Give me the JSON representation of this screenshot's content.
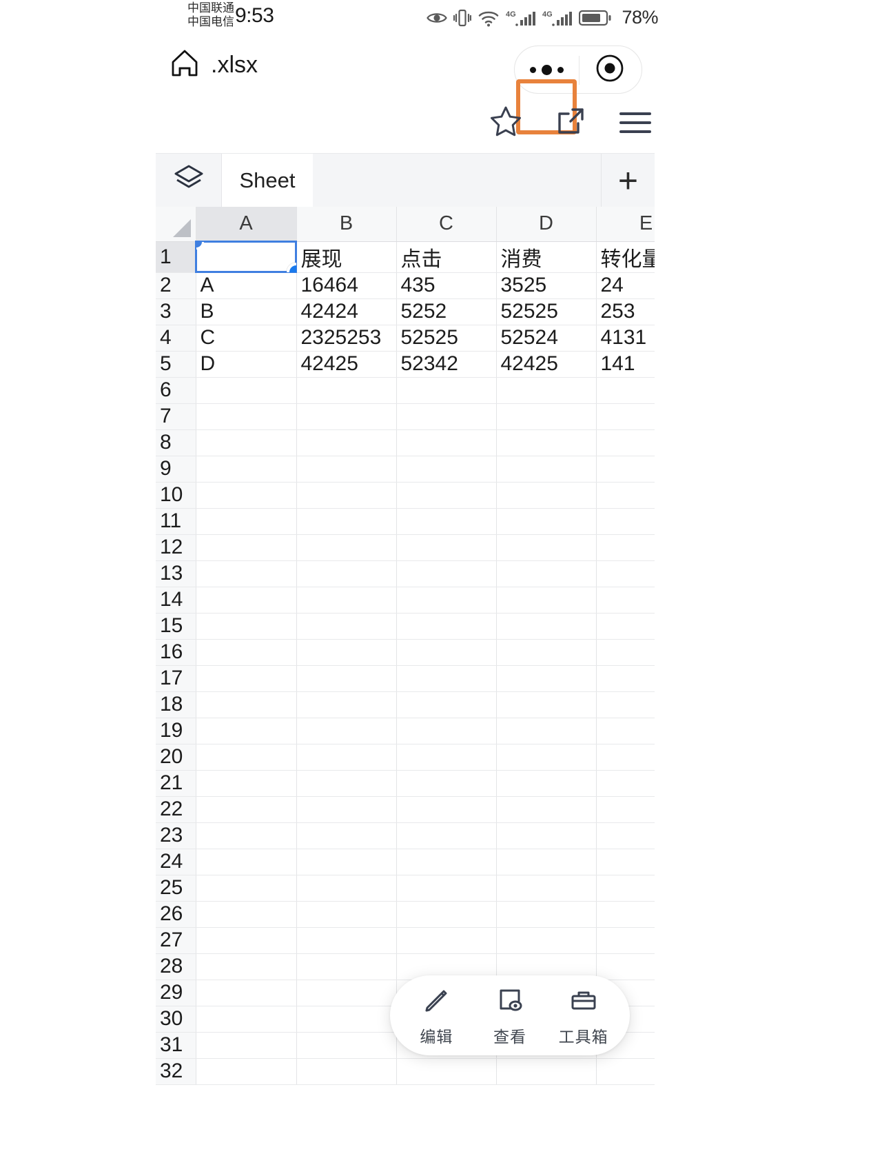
{
  "status_bar": {
    "carrier_1": "中国联通",
    "carrier_2": "中国电信",
    "time": "9:53",
    "battery_percent": "78%",
    "icons": [
      "eye-care-icon",
      "vibrate-icon",
      "wifi-icon",
      "signal-4g-icon",
      "signal-4g-icon-2",
      "battery-icon"
    ]
  },
  "title_bar": {
    "home_icon": "home-icon",
    "file_name": ".xlsx",
    "more_icon": "more-dots-icon",
    "target_icon": "target-icon",
    "highlight_color": "#e8823c"
  },
  "action_row": {
    "favorite_label": "star-icon",
    "share_label": "share-external-icon",
    "menu_label": "hamburger-menu-icon"
  },
  "sheet_bar": {
    "layers_icon": "layers-icon",
    "tabs": [
      "Sheet"
    ],
    "active_tab": "Sheet",
    "add_label": "+"
  },
  "grid": {
    "columns": [
      "A",
      "B",
      "C",
      "D",
      "E"
    ],
    "row_numbers": [
      1,
      2,
      3,
      4,
      5,
      6,
      7,
      8,
      9,
      10,
      11,
      12,
      13,
      14,
      15,
      16,
      17,
      18,
      19,
      20,
      21,
      22,
      23,
      24,
      25,
      26,
      27,
      28,
      29,
      30,
      31,
      32
    ],
    "selected_cell": "A1",
    "selection_color": "#1a7aed",
    "rows": [
      {
        "n": 1,
        "cells": [
          "",
          "展现",
          "点击",
          "消费",
          "转化量"
        ]
      },
      {
        "n": 2,
        "cells": [
          "A",
          "16464",
          "435",
          "3525",
          "24"
        ]
      },
      {
        "n": 3,
        "cells": [
          "B",
          "42424",
          "5252",
          "52525",
          "253"
        ]
      },
      {
        "n": 4,
        "cells": [
          "C",
          "2325253",
          "52525",
          "52524",
          "4131"
        ]
      },
      {
        "n": 5,
        "cells": [
          "D",
          "42425",
          "52342",
          "42425",
          "141"
        ]
      },
      {
        "n": 6,
        "cells": [
          "",
          "",
          "",
          "",
          ""
        ]
      },
      {
        "n": 7,
        "cells": [
          "",
          "",
          "",
          "",
          ""
        ]
      },
      {
        "n": 8,
        "cells": [
          "",
          "",
          "",
          "",
          ""
        ]
      },
      {
        "n": 9,
        "cells": [
          "",
          "",
          "",
          "",
          ""
        ]
      },
      {
        "n": 10,
        "cells": [
          "",
          "",
          "",
          "",
          ""
        ]
      },
      {
        "n": 11,
        "cells": [
          "",
          "",
          "",
          "",
          ""
        ]
      },
      {
        "n": 12,
        "cells": [
          "",
          "",
          "",
          "",
          ""
        ]
      },
      {
        "n": 13,
        "cells": [
          "",
          "",
          "",
          "",
          ""
        ]
      },
      {
        "n": 14,
        "cells": [
          "",
          "",
          "",
          "",
          ""
        ]
      },
      {
        "n": 15,
        "cells": [
          "",
          "",
          "",
          "",
          ""
        ]
      },
      {
        "n": 16,
        "cells": [
          "",
          "",
          "",
          "",
          ""
        ]
      },
      {
        "n": 17,
        "cells": [
          "",
          "",
          "",
          "",
          ""
        ]
      },
      {
        "n": 18,
        "cells": [
          "",
          "",
          "",
          "",
          ""
        ]
      },
      {
        "n": 19,
        "cells": [
          "",
          "",
          "",
          "",
          ""
        ]
      },
      {
        "n": 20,
        "cells": [
          "",
          "",
          "",
          "",
          ""
        ]
      },
      {
        "n": 21,
        "cells": [
          "",
          "",
          "",
          "",
          ""
        ]
      },
      {
        "n": 22,
        "cells": [
          "",
          "",
          "",
          "",
          ""
        ]
      },
      {
        "n": 23,
        "cells": [
          "",
          "",
          "",
          "",
          ""
        ]
      },
      {
        "n": 24,
        "cells": [
          "",
          "",
          "",
          "",
          ""
        ]
      },
      {
        "n": 25,
        "cells": [
          "",
          "",
          "",
          "",
          ""
        ]
      },
      {
        "n": 26,
        "cells": [
          "",
          "",
          "",
          "",
          ""
        ]
      },
      {
        "n": 27,
        "cells": [
          "",
          "",
          "",
          "",
          ""
        ]
      },
      {
        "n": 28,
        "cells": [
          "",
          "",
          "",
          "",
          ""
        ]
      },
      {
        "n": 29,
        "cells": [
          "",
          "",
          "",
          "",
          ""
        ]
      },
      {
        "n": 30,
        "cells": [
          "",
          "",
          "",
          "",
          ""
        ]
      },
      {
        "n": 31,
        "cells": [
          "",
          "",
          "",
          "",
          ""
        ]
      },
      {
        "n": 32,
        "cells": [
          "",
          "",
          "",
          "",
          ""
        ]
      }
    ]
  },
  "float_toolbar": {
    "items": [
      {
        "label": "编辑",
        "icon": "pencil-icon"
      },
      {
        "label": "查看",
        "icon": "view-eye-icon"
      },
      {
        "label": "工具箱",
        "icon": "toolbox-icon"
      }
    ]
  }
}
